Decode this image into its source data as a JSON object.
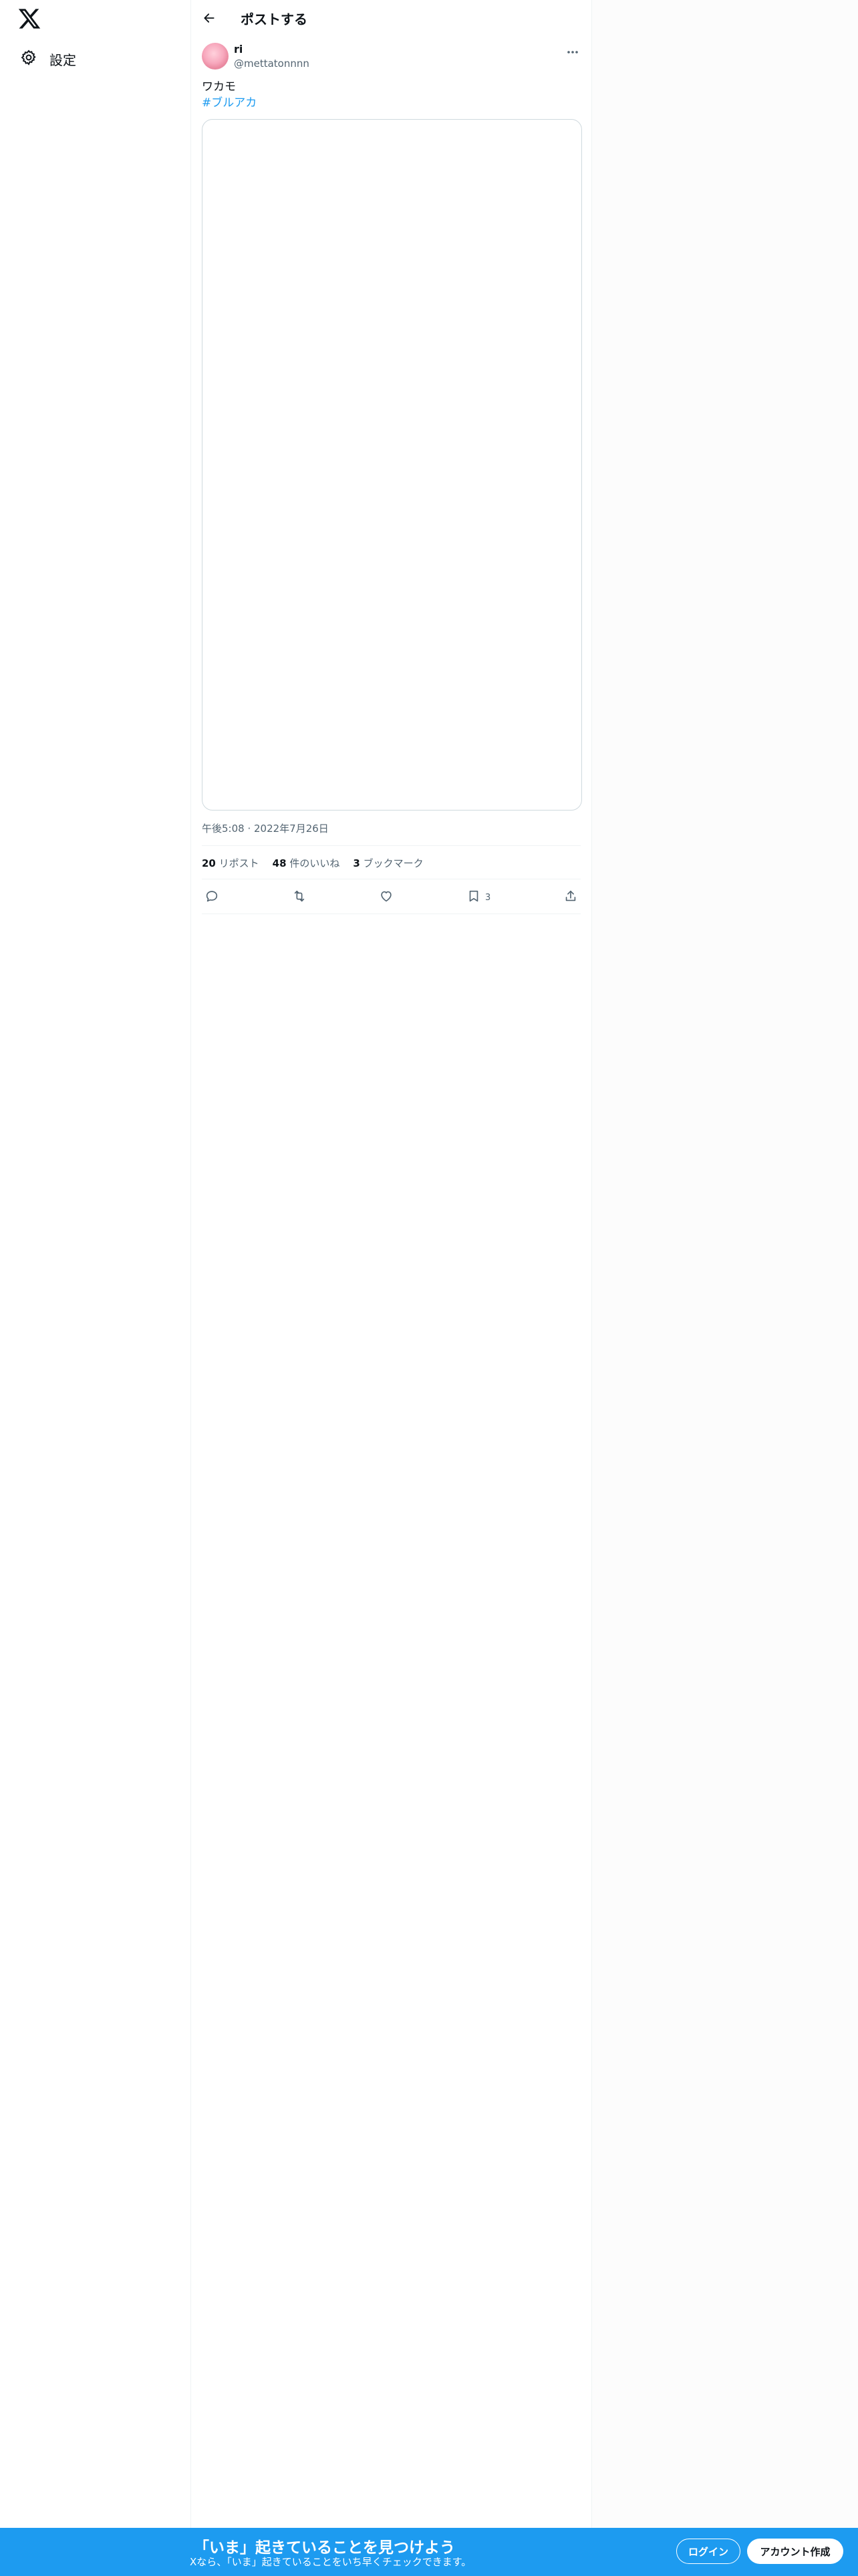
{
  "sidebar": {
    "logo_icon": "x-logo-icon",
    "settings_label": "設定",
    "settings_icon": "gear-icon"
  },
  "header": {
    "back_icon": "arrow-left-icon",
    "title": "ポストする"
  },
  "post": {
    "author_name": "ri",
    "author_handle": "@mettatonnnn",
    "more_icon": "more-horizontal-icon",
    "text": "ワカモ",
    "hashtag": "#ブルアカ",
    "timestamp": "午後5:08 · 2022年7月26日",
    "stats": {
      "reposts_count": "20",
      "reposts_label": "リポスト",
      "likes_count": "48",
      "likes_label": "件のいいね",
      "bookmarks_count": "3",
      "bookmarks_label": "ブックマーク"
    },
    "actions": {
      "reply_icon": "reply-icon",
      "repost_icon": "repost-icon",
      "like_icon": "heart-icon",
      "bookmark_icon": "bookmark-icon",
      "bookmark_count": "3",
      "share_icon": "share-icon"
    }
  },
  "bottom_bar": {
    "title": "「いま」起きていることを見つけよう",
    "subtitle": "Xなら、「いま」起きていることをいち早くチェックできます。",
    "login_label": "ログイン",
    "signup_label": "アカウント作成",
    "background_color": "#1d9bf0"
  },
  "colors": {
    "accent": "#1d9bf0",
    "text_primary": "#0f1419",
    "text_secondary": "#536471"
  }
}
